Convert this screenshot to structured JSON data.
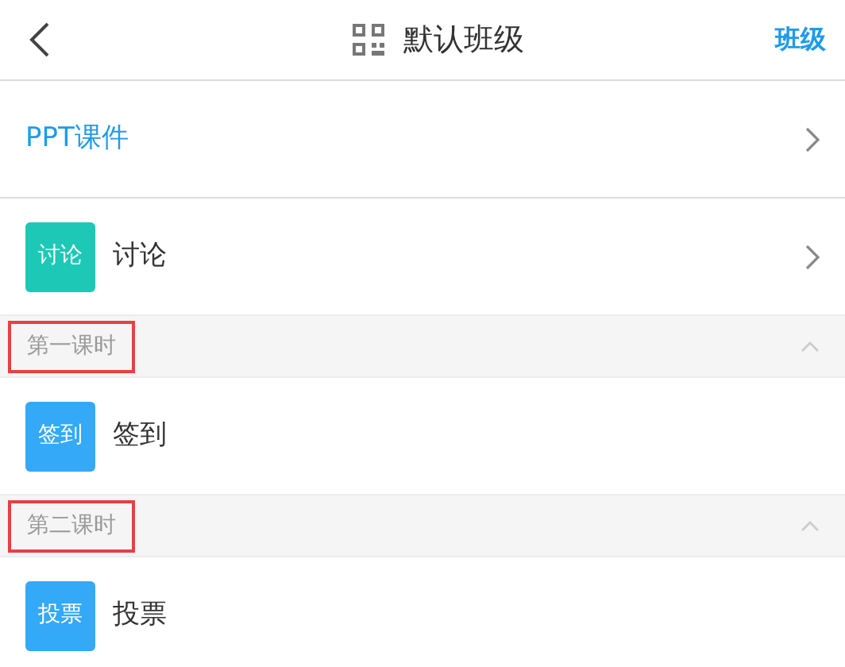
{
  "header": {
    "title": "默认班级",
    "action": "班级"
  },
  "rows": [
    {
      "kind": "link",
      "label": "PPT课件"
    },
    {
      "kind": "activity",
      "badge": "讨论",
      "label": "讨论",
      "color": "#1ec8b6",
      "chevron": true
    },
    {
      "kind": "section",
      "label": "第一课时",
      "highlighted": true,
      "expanded": true
    },
    {
      "kind": "activity",
      "badge": "签到",
      "label": "签到",
      "color": "#33a9f7",
      "chevron": false
    },
    {
      "kind": "section",
      "label": "第二课时",
      "highlighted": true,
      "expanded": true
    },
    {
      "kind": "activity",
      "badge": "投票",
      "label": "投票",
      "color": "#33a9f7",
      "chevron": false
    }
  ]
}
